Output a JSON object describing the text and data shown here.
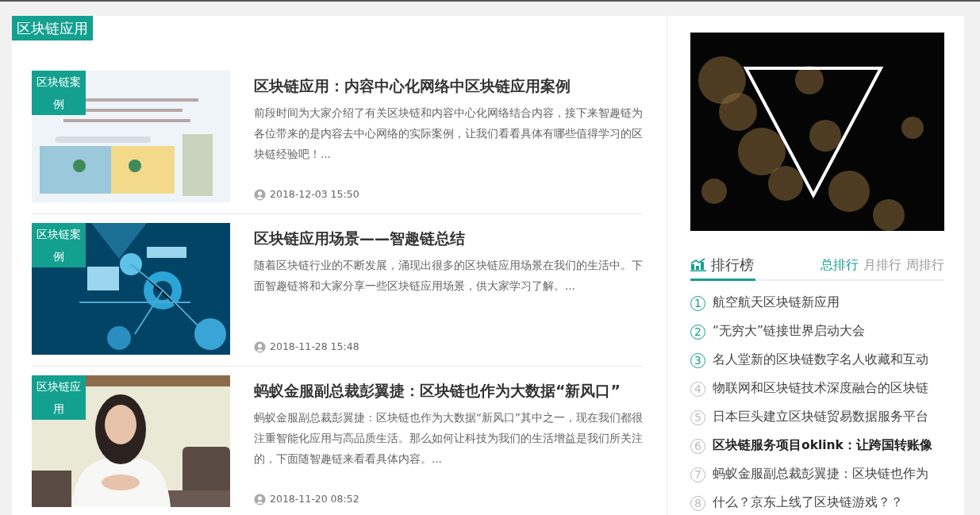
{
  "section_tag": "区块链应用",
  "articles": [
    {
      "tag": "区块链案例",
      "title": "区块链应用：内容中心化网络中区块链应用案例",
      "excerpt": "前段时间为大家介绍了有关区块链和内容中心化网络结合内容，接下来智趣链为各位带来的是内容去中心网络的实际案例，让我们看看具体有哪些值得学习的区块链经验吧！...",
      "date": "2018-12-03 15:50"
    },
    {
      "tag": "区块链案例",
      "title": "区块链应用场景——智趣链总结",
      "excerpt": "随着区块链行业的不断发展，涌现出很多的区块链应用场景在我们的生活中。下面智趣链将和大家分享一些区块链应用场景，供大家学习了解。...",
      "date": "2018-11-28 15:48"
    },
    {
      "tag": "区块链应用",
      "title": "蚂蚁金服副总裁彭翼捷：区块链也作为大数据“新风口”",
      "excerpt": "蚂蚁金服副总裁彭翼捷：区块链也作为大数据“新风口”其中之一，现在我们都很注重智能化应用与高品质生活。那么如何让科技为我们的生活增益是我们所关注的，下面随智趣链来看看具体内容。...",
      "date": "2018-11-20 08:52"
    }
  ],
  "ranking": {
    "title": "排行榜",
    "tabs": [
      {
        "label": "总排行",
        "selected": true
      },
      {
        "label": "月排行",
        "selected": false
      },
      {
        "label": "周排行",
        "selected": false
      }
    ],
    "items": [
      {
        "number": "1",
        "text": "航空航天区块链新应用",
        "top": true,
        "hovered": false
      },
      {
        "number": "2",
        "text": "“无穷大”链接世界启动大会",
        "top": true,
        "hovered": false
      },
      {
        "number": "3",
        "text": "名人堂新的区块链数字名人收藏和互动",
        "top": true,
        "hovered": false
      },
      {
        "number": "4",
        "text": "物联网和区块链技术深度融合的区块链",
        "top": false,
        "hovered": false
      },
      {
        "number": "5",
        "text": "日本巨头建立区块链贸易数据服务平台",
        "top": false,
        "hovered": false
      },
      {
        "number": "6",
        "text": "区块链服务项目oklink：让跨国转账像",
        "top": false,
        "hovered": true
      },
      {
        "number": "7",
        "text": "蚂蚁金服副总裁彭翼捷：区块链也作为",
        "top": false,
        "hovered": false
      },
      {
        "number": "8",
        "text": "什么？京东上线了区块链游戏？？",
        "top": false,
        "hovered": false
      }
    ]
  }
}
